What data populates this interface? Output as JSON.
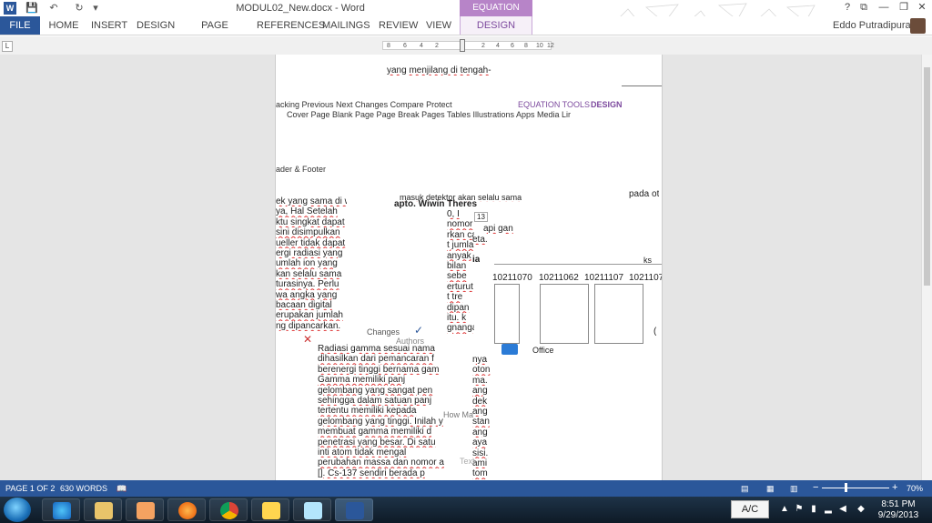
{
  "titlebar": {
    "title": "MODUL02_New.docx - Word",
    "contextual_group": "EQUATION TOOLS",
    "qat": {
      "word_icon": "W",
      "save": "💾",
      "undo": "↶",
      "redo": "↻",
      "customize": "▾"
    },
    "window": {
      "help": "?",
      "ribbon_display": "⧉",
      "minimize": "—",
      "restore": "❐",
      "close": "✕"
    }
  },
  "ribbon": {
    "tabs": [
      "FILE",
      "HOME",
      "INSERT",
      "DESIGN",
      "PAGE LAYOUT",
      "REFERENCES",
      "MAILINGS",
      "REVIEW",
      "VIEW",
      "DESIGN"
    ],
    "user": "Eddo Putradipura"
  },
  "ruler": {
    "numbers": [
      "8",
      "6",
      "4",
      "2",
      "2",
      "4",
      "6",
      "8",
      "10",
      "12"
    ],
    "tab_selector": "L"
  },
  "document": {
    "top_lines": [
      "yang menjilang di tengah-"
    ],
    "ribbon_ghost": {
      "row1": "acking   Previous   Next  Changes Compare Protect",
      "eq_tools": "EQUATION TOOLS",
      "eq_design": "DESIGN",
      "row2": "Cover Page  Blank Page  Page Break  Pages Tables Illustrations Apps Media Lir",
      "header_footer": "ader & Footer"
    },
    "mid_fragment": "masuk detektor akan selalu sama",
    "pada": "pada ot",
    "caption": "apto. Wiwin Theres",
    "left_col": [
      "ek yang sama di waktu",
      "ya, Hal Setelah",
      "ktu singkat dapat",
      "sini disimpulkan",
      "ueller tidak dapat",
      "ergi radiasi yang",
      "umlah ion yang",
      "kan selalu sama",
      "turasinya. Perlu",
      "wa angka yang",
      "bacaan digital",
      "erupakan jumlah",
      "ng dipancarkan."
    ],
    "mid_col": [
      "0, I",
      "nomor atom",
      "rkan can",
      "t jumla",
      "anyak",
      "bilan",
      "sebe",
      "erturut",
      "t tre",
      "dipan",
      "itu. k",
      "gnanga"
    ],
    "right_scrap": [
      "api gan",
      "eta."
    ],
    "label_13": "13",
    "ia": "ia",
    "ks": "ks",
    "table_ids": [
      "10211070",
      "10211062",
      "10211107",
      "1021107"
    ],
    "office": "Office",
    "paren": "(",
    "ghost_changes": "Changes",
    "ghost_authors": "Authors",
    "main_para": [
      "Radiasi gamma sesuai nama",
      "dihasilkan dari pemancaran f",
      "berenergi tinggi bernama gam",
      "Gamma memiliki panj",
      "gelombang yang sangat pen",
      "sehingga dalam satuan panj",
      "tertentu memiliki kepada",
      "gelombang yang tinggi. Inilah y",
      "membuat gamma memiliki d",
      "penetrasi yang besar. Di satu",
      "inti atom tidak mengal",
      "perubahan massa dan nomor a",
      "[]. Cs-137 sendiri berada p"
    ],
    "right_tail": [
      "nya",
      "oton",
      "ma.",
      "ang",
      "dek",
      "ang",
      "stan",
      "ang",
      "aya",
      "sisi.",
      "ami",
      "tom"
    ],
    "how_ma": "How Ma",
    "text_ghost": "Text"
  },
  "statusbar": {
    "page": "PAGE 1 OF 2",
    "words": "630 WORDS",
    "zoom": "70%",
    "zoom_minus": "−",
    "zoom_plus": "+",
    "zoom_level": 0.7
  },
  "taskbar": {
    "input_indicator": "A/C",
    "time": "8:51 PM",
    "date": "9/29/2013"
  },
  "colors": {
    "word_blue": "#2b579a",
    "eq_purple": "#b784c8"
  }
}
